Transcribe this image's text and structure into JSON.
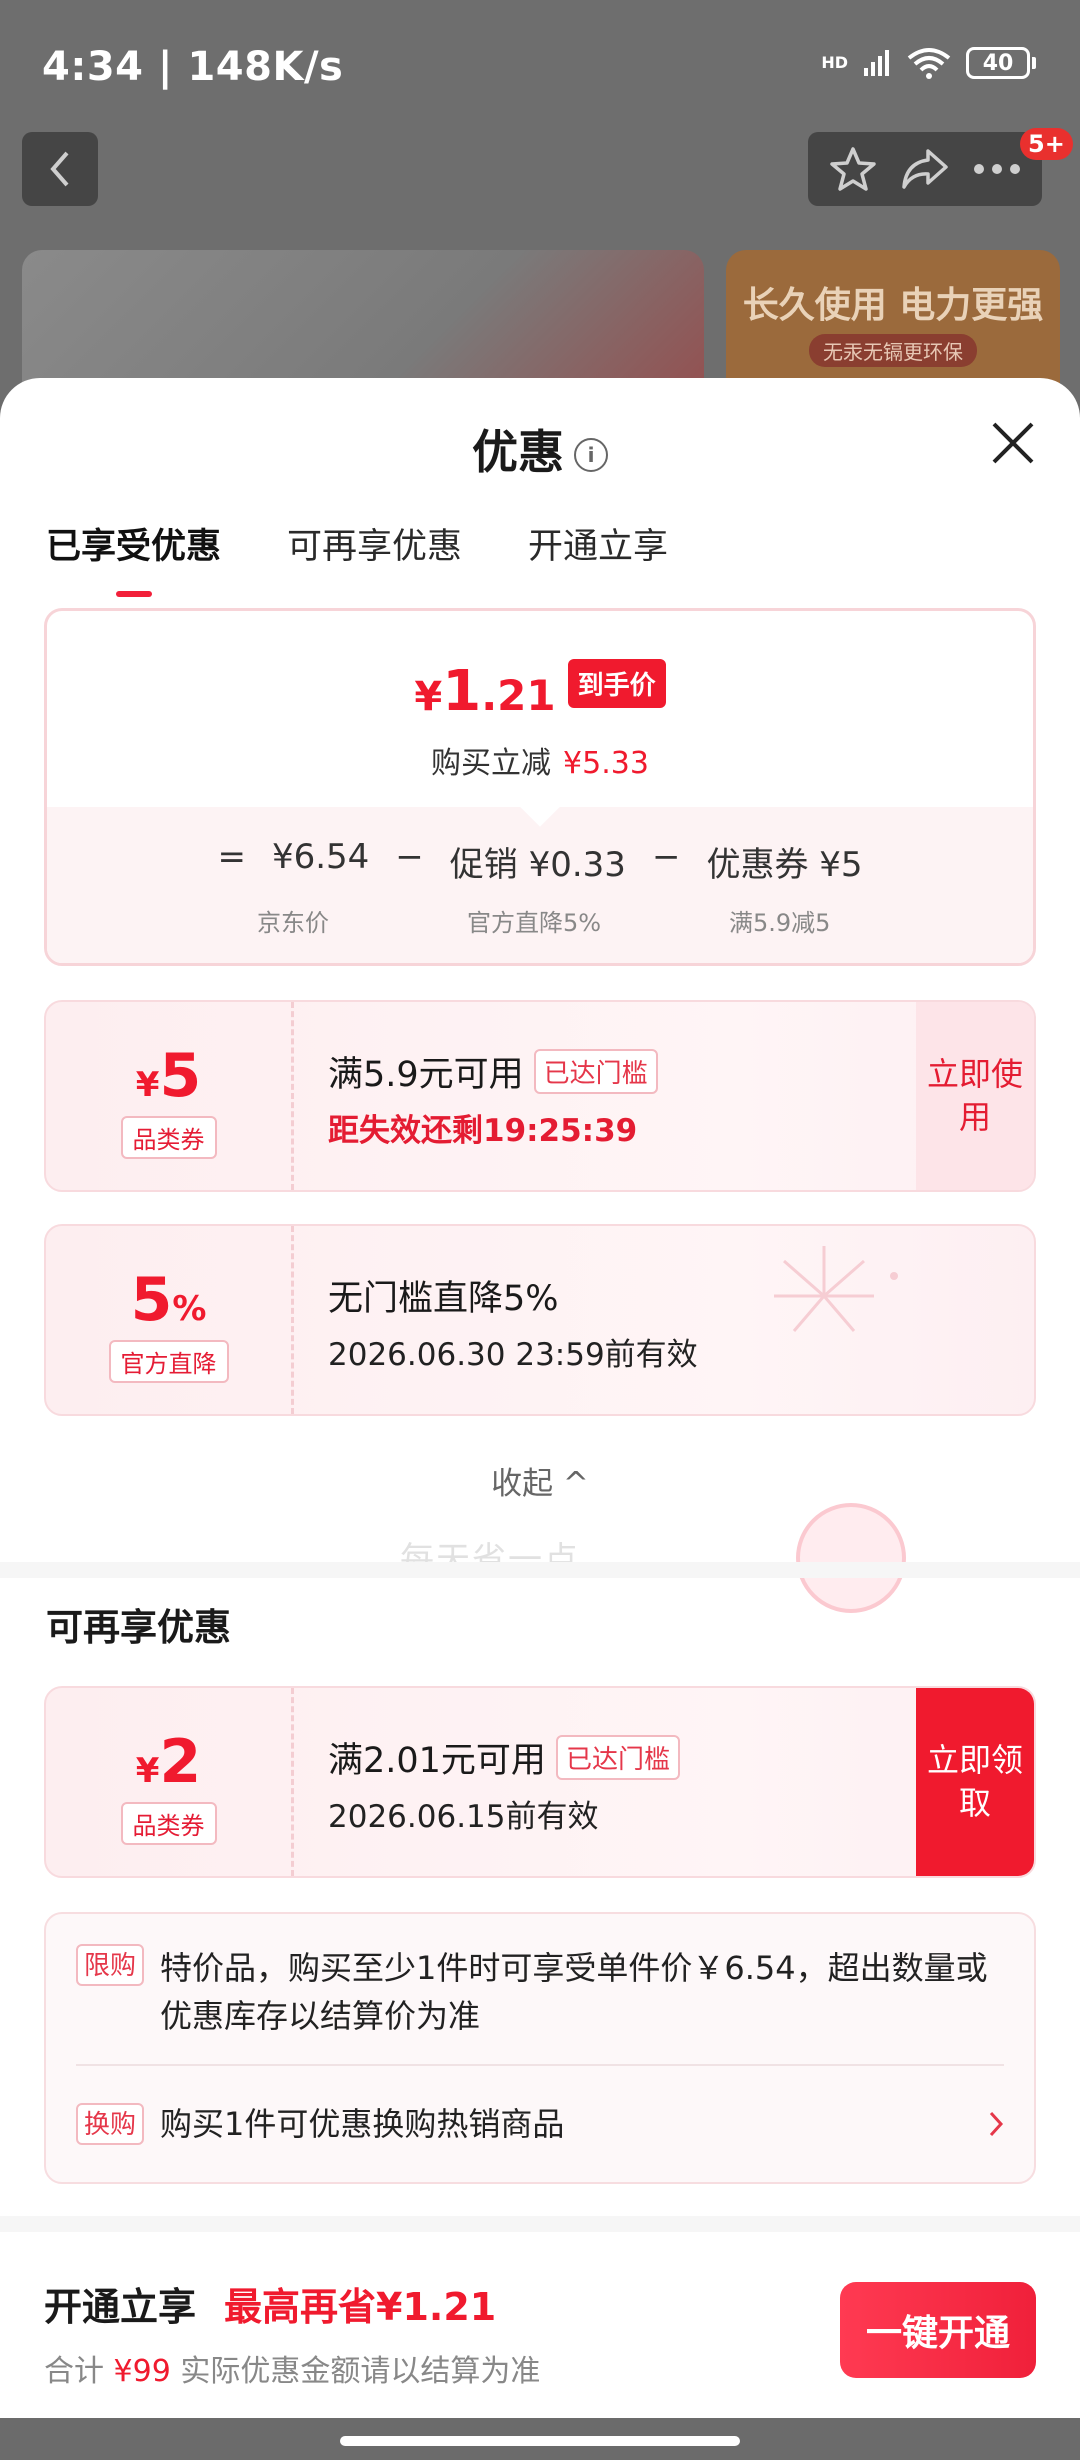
{
  "status_bar": {
    "time_speed": "4:34 | 148K/s",
    "network": "HD",
    "battery": "40"
  },
  "top_nav": {
    "badge": "5+"
  },
  "banner": {
    "title": "长久使用 电力更强",
    "subtitle": "无汞无镉更环保"
  },
  "sheet": {
    "title": "优惠"
  },
  "tabs": [
    "已享受优惠",
    "可再享优惠",
    "开通立享"
  ],
  "price_card": {
    "yen": "¥",
    "price_int": "1",
    "price_dec": ".21",
    "tag": "到手价",
    "reduce_label": "购买立减",
    "reduce_value": "¥5.33",
    "formula": [
      "=",
      "¥6.54",
      "−",
      "促销 ¥0.33",
      "−",
      "优惠券 ¥5"
    ],
    "labels": [
      "京东价",
      "官方直降5%",
      "满5.9减5"
    ]
  },
  "coupon1": {
    "symbol": "¥",
    "amount": "5",
    "kind": "品类券",
    "condition": "满5.9元可用",
    "chip": "已达门槛",
    "line2": "距失效还剩19:25:39",
    "action": "立即使用"
  },
  "coupon2": {
    "amount": "5",
    "unit": "%",
    "kind": "官方直降",
    "condition": "无门槛直降5%",
    "line2": "2026.06.30 23:59前有效"
  },
  "watermark": "每天省一点",
  "collapse_label": "收起 ^",
  "section2_title": "可再享优惠",
  "coupon3": {
    "symbol": "¥",
    "amount": "2",
    "kind": "品类券",
    "condition": "满2.01元可用",
    "chip": "已达门槛",
    "line2": "2026.06.15前有效",
    "action": "立即领取"
  },
  "info": {
    "limit_tag": "限购",
    "limit_text": "特价品，购买至少1件时可享受单件价￥6.54，超出数量或优惠库存以结算价为准",
    "swap_tag": "换购",
    "swap_text": "购买1件可优惠换购热销商品"
  },
  "bottom": {
    "label": "开通立享",
    "save": "最高再省¥1.21",
    "total_label": "合计",
    "total_value": "¥99",
    "note": "实际优惠金额请以结算为准",
    "button": "一键开通"
  }
}
